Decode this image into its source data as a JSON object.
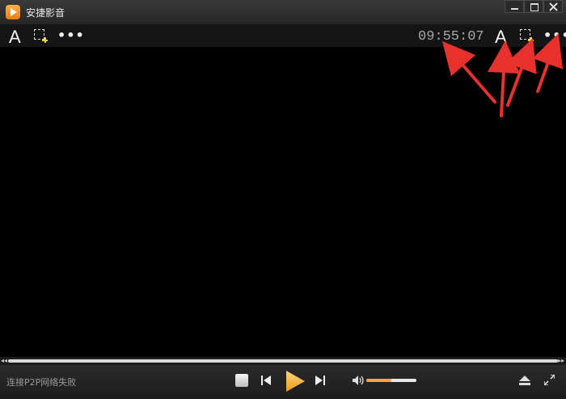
{
  "window": {
    "title": "安捷影音"
  },
  "toolbar": {
    "font_label": "A",
    "more_label": "•••",
    "clock": "09:55:07"
  },
  "status": {
    "text": "连接P2P网络失败"
  },
  "progress": {
    "played_fraction": 0
  },
  "volume": {
    "level_fraction": 0.5
  },
  "colors": {
    "accent": "#f0a830",
    "annotation_arrow": "#e8302c",
    "background": "#000000"
  },
  "icons": [
    "app-logo-icon",
    "minimize-icon",
    "maximize-icon",
    "close-icon",
    "font-icon",
    "screenshot-icon",
    "more-icon",
    "stop-icon",
    "previous-icon",
    "play-icon",
    "next-icon",
    "volume-icon",
    "eject-icon",
    "fullscreen-icon"
  ]
}
